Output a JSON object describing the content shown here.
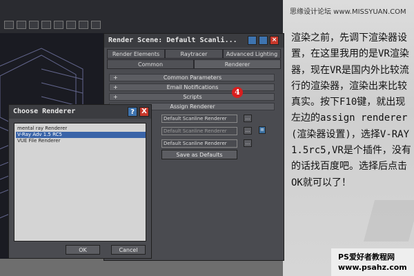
{
  "site": {
    "banner": "思缘设计论坛 www.MISSYUAN.COM",
    "footer_line1": "PS爱好者教程网",
    "footer_line2": "www.psahz.com"
  },
  "description": "渲染之前，先调下渲染器设置，在这里我用的是VR渲染器，现在VR是国内外比较流行的渲染器，渲染出来比较真实。按下F10键，就出现左边的assign renderer(渲染器设置)，选择V-RAY1.5rc5,VR是个插件，没有的话找百度吧。选择后点击OK就可以了！",
  "render_scene": {
    "title": "Render Scene: Default Scanli...",
    "tabs_row1": [
      "Render Elements",
      "Raytracer",
      "Advanced Lighting"
    ],
    "tabs_row2": [
      "Common",
      "Renderer"
    ],
    "rollouts": [
      {
        "sign": "+",
        "label": "Common Parameters"
      },
      {
        "sign": "+",
        "label": "Email Notifications"
      },
      {
        "sign": "+",
        "label": "Scripts"
      },
      {
        "sign": "-",
        "label": "Assign Renderer"
      }
    ],
    "renderer_rows": [
      {
        "value": "Default Scanline Renderer",
        "button": "..."
      },
      {
        "value": "Default Scanline Renderer",
        "button": "..."
      },
      {
        "value": "Default Scanline Renderer",
        "button": "..."
      }
    ],
    "save_defaults": "Save as Defaults",
    "lock_icon": "lock-icon"
  },
  "step_marker": "4",
  "choose_renderer": {
    "title": "Choose Renderer",
    "help": "?",
    "close": "X",
    "items": [
      "mental ray Renderer",
      "V-Ray Adv 1.5 RC5",
      "VUE File Renderer"
    ],
    "selected_index": 1,
    "ok": "OK",
    "cancel": "Cancel"
  },
  "colors": {
    "selection": "#3a64a8",
    "marker": "#d81e1e",
    "window_bg": "#4a4b50"
  }
}
